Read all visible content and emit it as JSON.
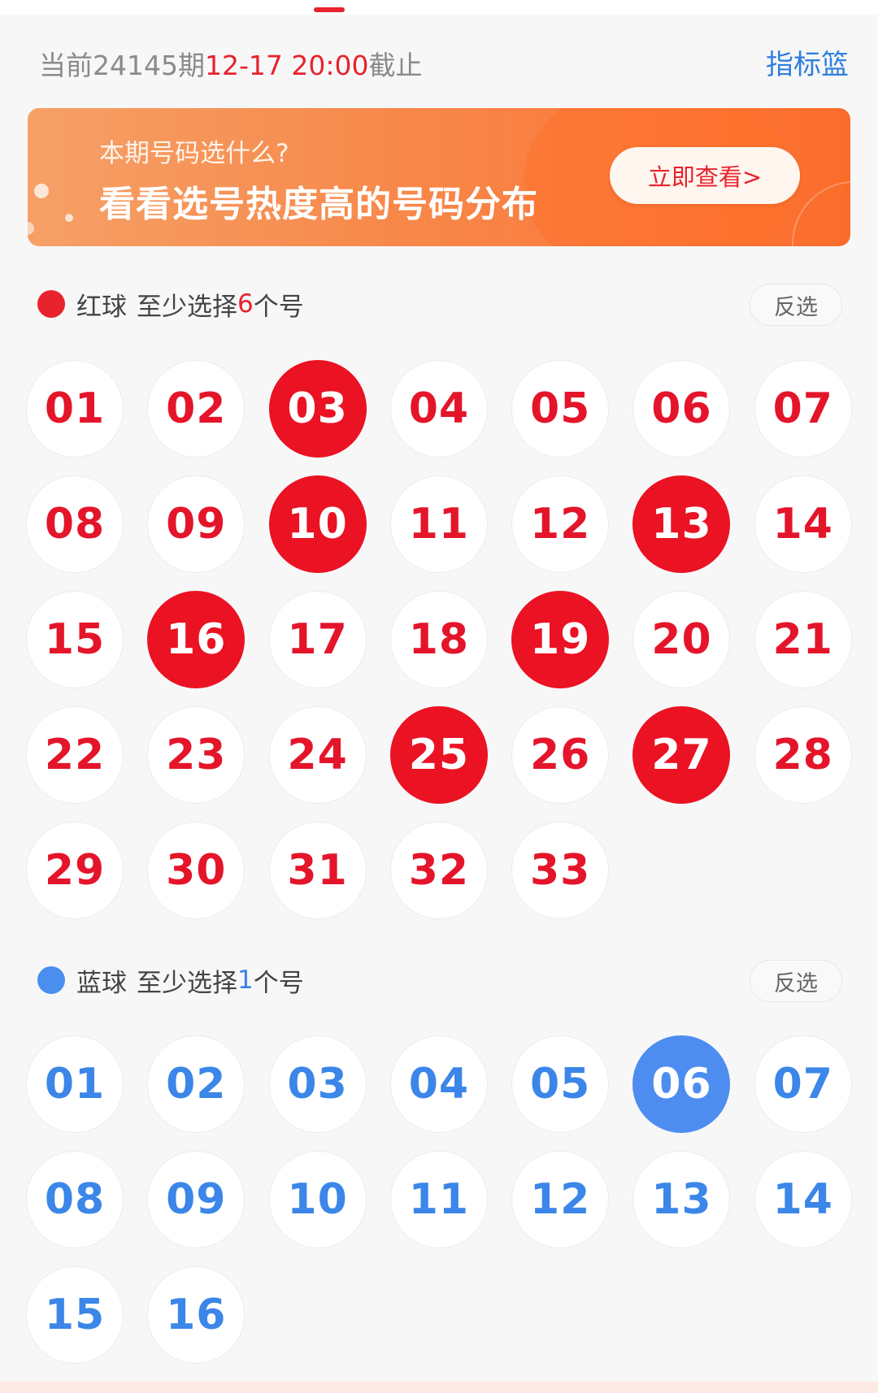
{
  "header": {
    "period_prefix": "当前24145期",
    "deadline_time": "12-17 20:00",
    "deadline_suffix": "截止",
    "basket_label": "指标篮"
  },
  "banner": {
    "subtitle": "本期号码选什么?",
    "title": "看看选号热度高的号码分布",
    "button_label": "立即查看>"
  },
  "red_section": {
    "label": "红球",
    "hint_prefix": "至少选择",
    "hint_count": "6",
    "hint_suffix": "个号",
    "invert_label": "反选",
    "balls": [
      {
        "n": "01",
        "sel": false
      },
      {
        "n": "02",
        "sel": false
      },
      {
        "n": "03",
        "sel": true
      },
      {
        "n": "04",
        "sel": false
      },
      {
        "n": "05",
        "sel": false
      },
      {
        "n": "06",
        "sel": false
      },
      {
        "n": "07",
        "sel": false
      },
      {
        "n": "08",
        "sel": false
      },
      {
        "n": "09",
        "sel": false
      },
      {
        "n": "10",
        "sel": true
      },
      {
        "n": "11",
        "sel": false
      },
      {
        "n": "12",
        "sel": false
      },
      {
        "n": "13",
        "sel": true
      },
      {
        "n": "14",
        "sel": false
      },
      {
        "n": "15",
        "sel": false
      },
      {
        "n": "16",
        "sel": true
      },
      {
        "n": "17",
        "sel": false
      },
      {
        "n": "18",
        "sel": false
      },
      {
        "n": "19",
        "sel": true
      },
      {
        "n": "20",
        "sel": false
      },
      {
        "n": "21",
        "sel": false
      },
      {
        "n": "22",
        "sel": false
      },
      {
        "n": "23",
        "sel": false
      },
      {
        "n": "24",
        "sel": false
      },
      {
        "n": "25",
        "sel": true
      },
      {
        "n": "26",
        "sel": false
      },
      {
        "n": "27",
        "sel": true
      },
      {
        "n": "28",
        "sel": false
      },
      {
        "n": "29",
        "sel": false
      },
      {
        "n": "30",
        "sel": false
      },
      {
        "n": "31",
        "sel": false
      },
      {
        "n": "32",
        "sel": false
      },
      {
        "n": "33",
        "sel": false
      }
    ]
  },
  "blue_section": {
    "label": "蓝球",
    "hint_prefix": "至少选择",
    "hint_count": "1",
    "hint_suffix": "个号",
    "invert_label": "反选",
    "balls": [
      {
        "n": "01",
        "sel": false
      },
      {
        "n": "02",
        "sel": false
      },
      {
        "n": "03",
        "sel": false
      },
      {
        "n": "04",
        "sel": false
      },
      {
        "n": "05",
        "sel": false
      },
      {
        "n": "06",
        "sel": true
      },
      {
        "n": "07",
        "sel": false
      },
      {
        "n": "08",
        "sel": false
      },
      {
        "n": "09",
        "sel": false
      },
      {
        "n": "10",
        "sel": false
      },
      {
        "n": "11",
        "sel": false
      },
      {
        "n": "12",
        "sel": false
      },
      {
        "n": "13",
        "sel": false
      },
      {
        "n": "14",
        "sel": false
      },
      {
        "n": "15",
        "sel": false
      },
      {
        "n": "16",
        "sel": false
      }
    ]
  },
  "colors": {
    "red": "#e8232d",
    "blue": "#4d8df0",
    "link_blue": "#2f7fe0"
  }
}
